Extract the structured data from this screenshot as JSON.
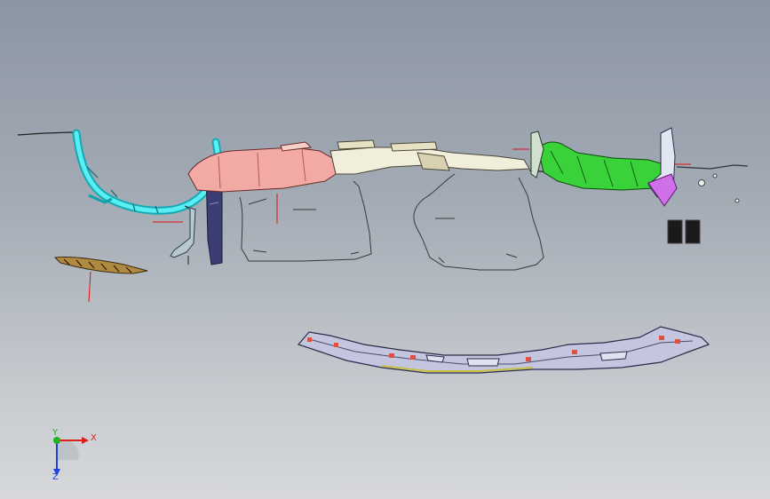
{
  "viewport": {
    "title": "",
    "background_top": "#8c96a3",
    "background_bottom": "#d6d8db"
  },
  "parts": [
    {
      "name": "fender-liner-arc",
      "color": "#2ad0d8"
    },
    {
      "name": "front-bracket-strip",
      "color": "#7a5a2a"
    },
    {
      "name": "a-pillar-trim",
      "color": "#3c4078"
    },
    {
      "name": "left-duct-panel",
      "color": "#f2a6a0"
    },
    {
      "name": "center-duct-panel",
      "color": "#f0ecd8"
    },
    {
      "name": "right-duct-panel",
      "color": "#34d030"
    },
    {
      "name": "right-end-cap",
      "color": "#d070e8"
    },
    {
      "name": "lower-bumper-beam",
      "color": "#b8b8d8"
    },
    {
      "name": "wire-harness-outline",
      "color": "#3a3a3a"
    },
    {
      "name": "black-clip-pair",
      "color": "#1a1a1a"
    }
  ],
  "triad": {
    "x_label": "X",
    "y_label": "Y",
    "z_label": "Z",
    "x_color": "#e02020",
    "y_color": "#20b020",
    "z_color": "#2040e0"
  }
}
